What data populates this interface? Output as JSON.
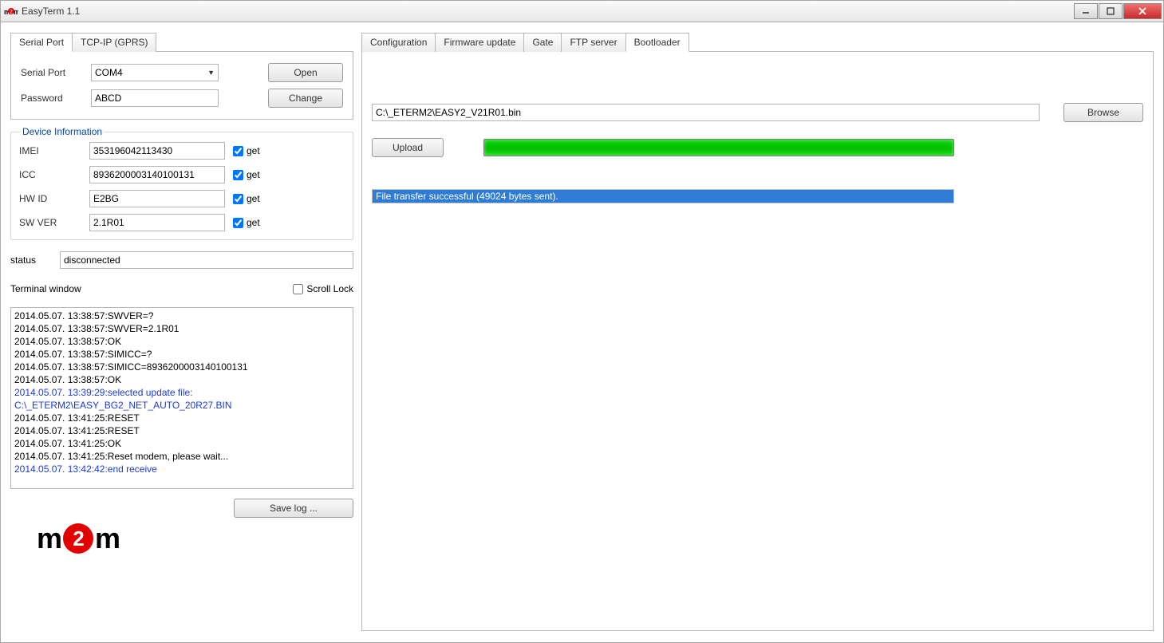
{
  "window": {
    "title": "EasyTerm 1.1"
  },
  "left": {
    "conn_tabs": [
      "Serial Port",
      "TCP-IP (GPRS)"
    ],
    "conn_active_tab": 0,
    "serial_port_label": "Serial Port",
    "serial_port_value": "COM4",
    "password_label": "Password",
    "password_value": "ABCD",
    "open_btn": "Open",
    "change_btn": "Change",
    "device_info_legend": "Device Information",
    "get_label": "get",
    "fields": [
      {
        "label": "IMEI",
        "value": "353196042113430",
        "checked": true
      },
      {
        "label": "ICC",
        "value": "8936200003140100131",
        "checked": true
      },
      {
        "label": "HW ID",
        "value": "E2BG",
        "checked": true
      },
      {
        "label": "SW VER",
        "value": "2.1R01",
        "checked": true
      }
    ],
    "status_label": "status",
    "status_value": "disconnected",
    "terminal_label": "Terminal window",
    "scroll_lock_label": "Scroll Lock",
    "scroll_lock_checked": false,
    "terminal": [
      {
        "t": "2014.05.07. 13:38:57:SWVER=?",
        "c": ""
      },
      {
        "t": "2014.05.07. 13:38:57:SWVER=2.1R01",
        "c": ""
      },
      {
        "t": "2014.05.07. 13:38:57:OK",
        "c": ""
      },
      {
        "t": "2014.05.07. 13:38:57:SIMICC=?",
        "c": ""
      },
      {
        "t": "2014.05.07. 13:38:57:SIMICC=8936200003140100131",
        "c": ""
      },
      {
        "t": "2014.05.07. 13:38:57:OK",
        "c": ""
      },
      {
        "t": "2014.05.07. 13:39:29:selected update file: C:\\_ETERM2\\EASY_BG2_NET_AUTO_20R27.BIN",
        "c": "blue"
      },
      {
        "t": "2014.05.07. 13:41:25:RESET",
        "c": ""
      },
      {
        "t": "2014.05.07. 13:41:25:RESET",
        "c": ""
      },
      {
        "t": "2014.05.07. 13:41:25:OK",
        "c": ""
      },
      {
        "t": "2014.05.07. 13:41:25:Reset modem, please wait...",
        "c": ""
      },
      {
        "t": "2014.05.07. 13:42:42:end receive",
        "c": "blue"
      }
    ],
    "save_log_btn": "Save log ..."
  },
  "right": {
    "tabs": [
      "Configuration",
      "Firmware update",
      "Gate",
      "FTP server",
      "Bootloader"
    ],
    "active_tab": 4,
    "bootloader": {
      "path": "C:\\_ETERM2\\EASY2_V21R01.bin",
      "browse_btn": "Browse",
      "upload_btn": "Upload",
      "status_msg": "File transfer successful (49024 bytes sent)."
    }
  }
}
